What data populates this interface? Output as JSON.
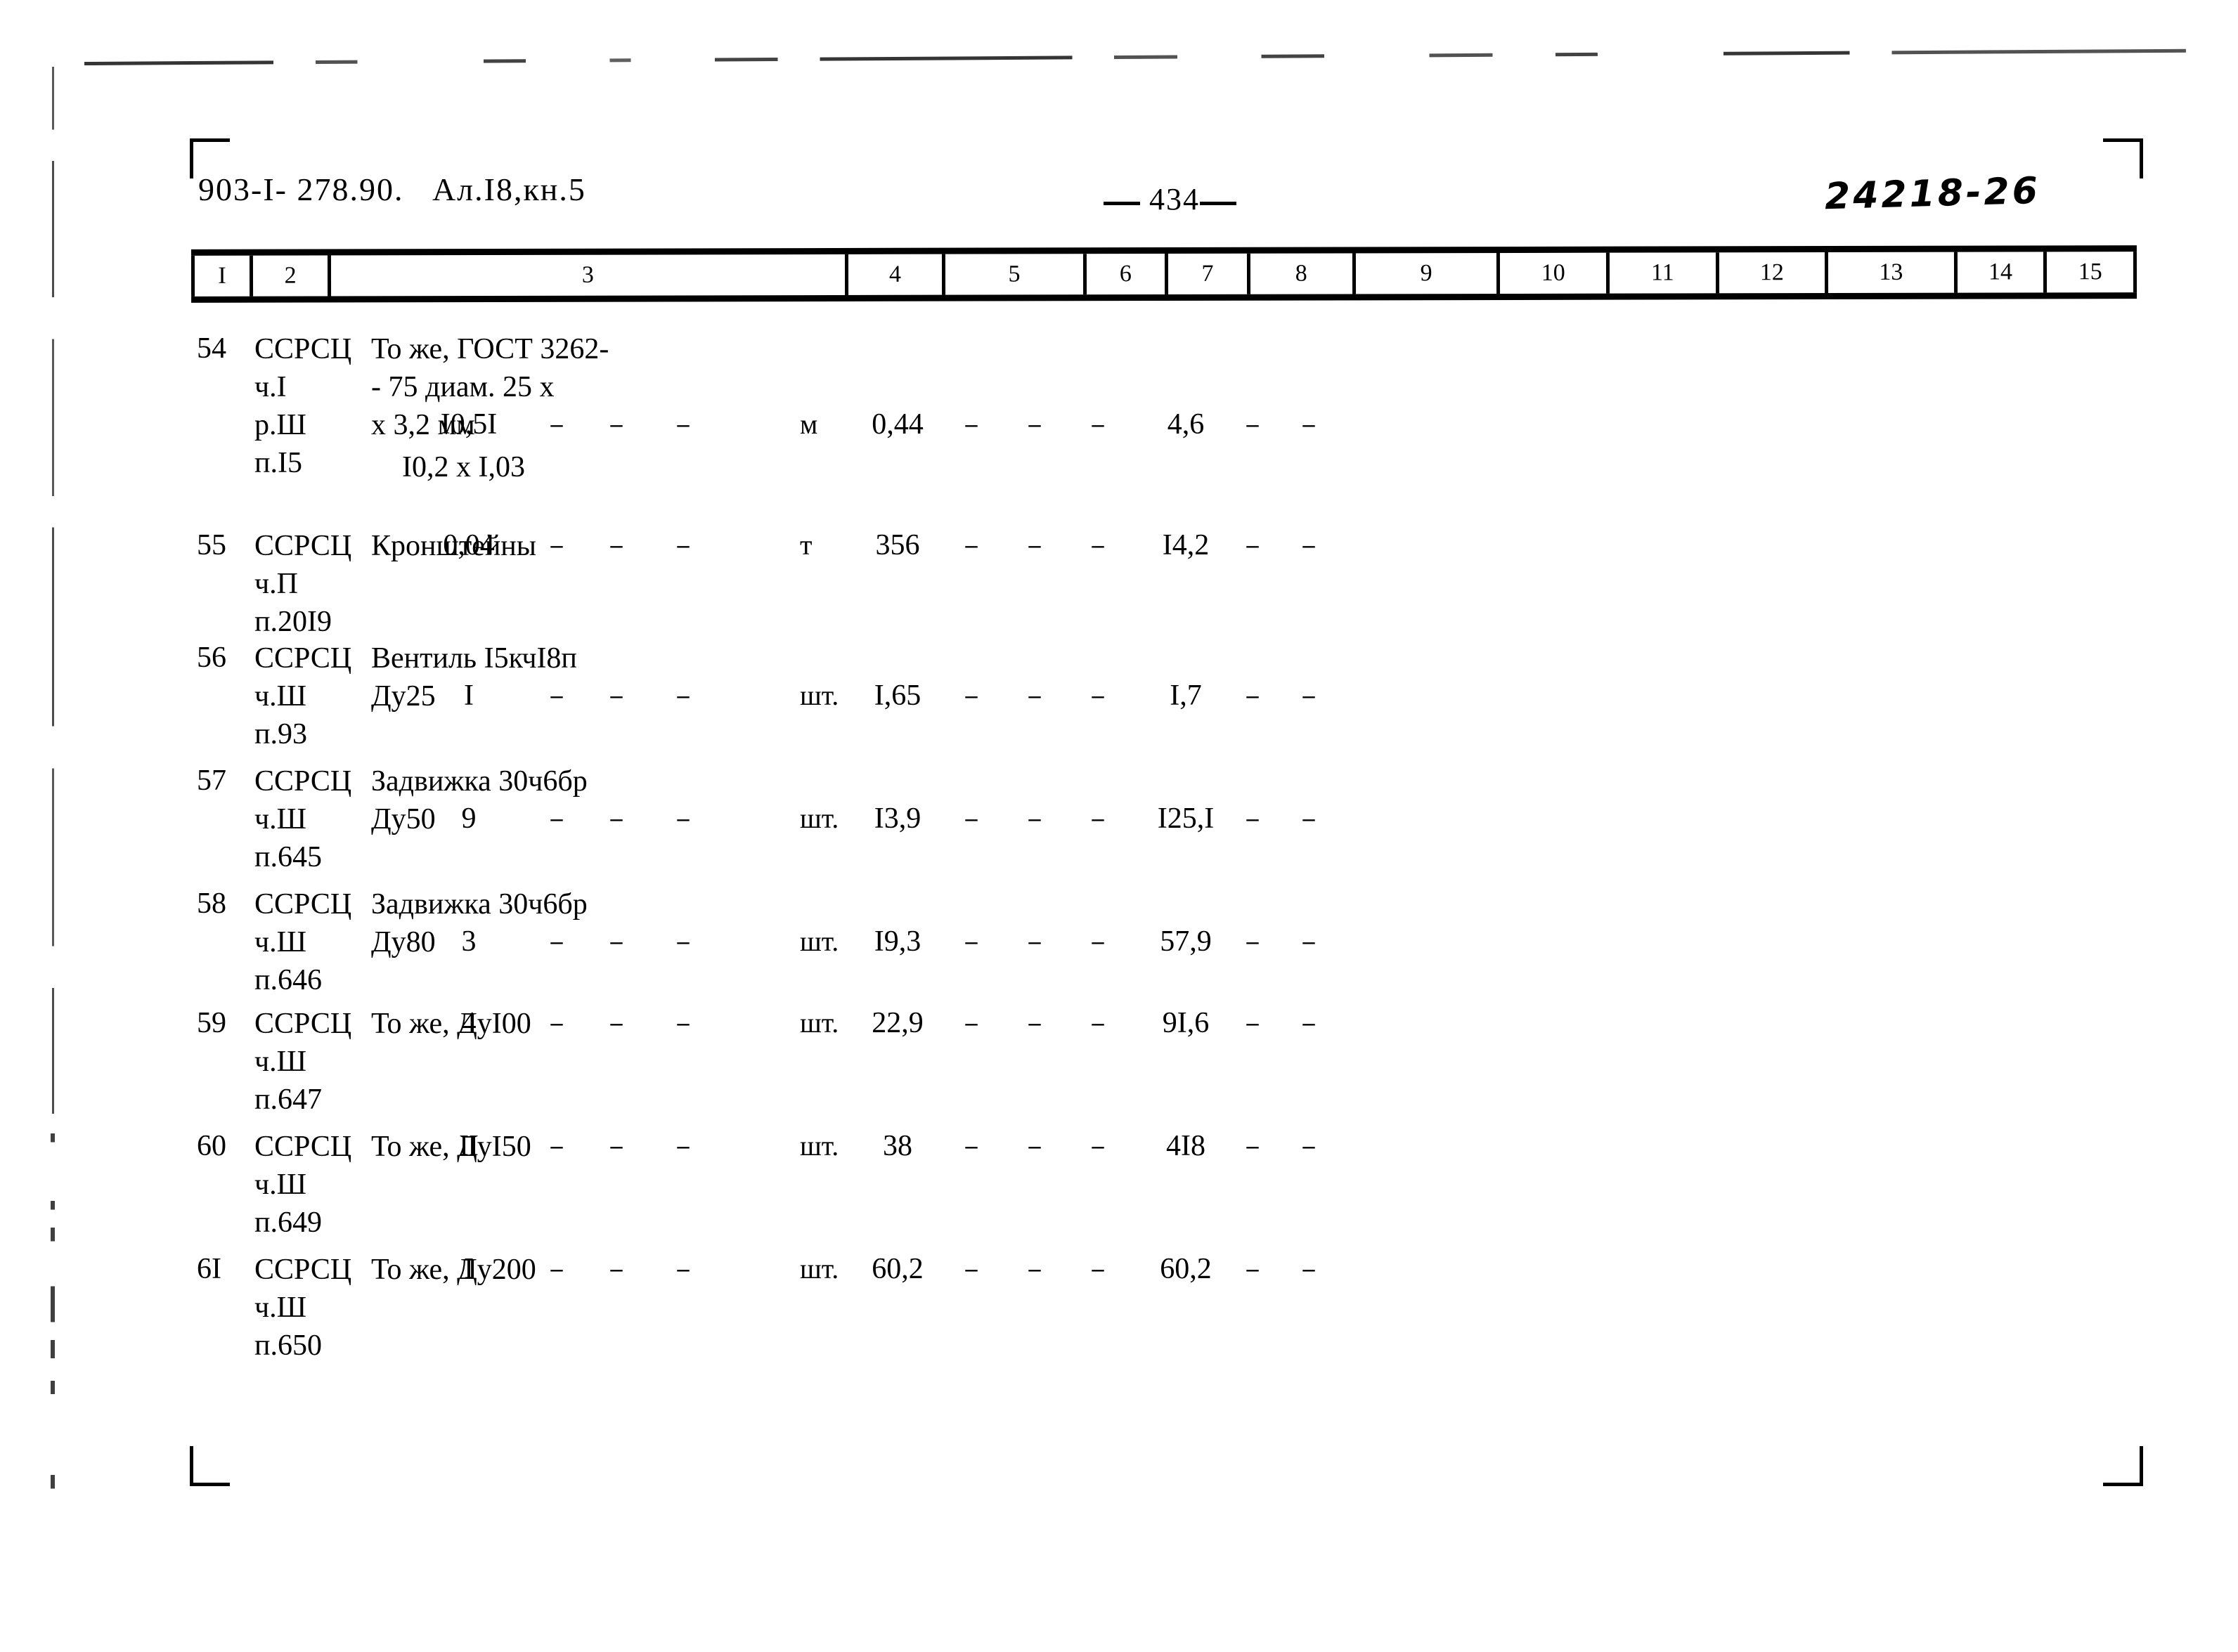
{
  "header": {
    "left_code": "903-I- 278.90.   Ал.I8,кн.5",
    "page_number": "434",
    "right_code": "24218-26"
  },
  "table": {
    "column_headers": [
      "I",
      "2",
      "3",
      "4",
      "5",
      "6",
      "7",
      "8",
      "9",
      "10",
      "11",
      "12",
      "13",
      "14",
      "15"
    ],
    "rows": [
      {
        "num": "54",
        "code": "ССРСЦ\nч.I\nр.Ш\nп.I5",
        "name": "То же, ГОСТ 3262-\n- 75 диам. 25 х\nх 3,2 мм",
        "name_extra": "I0,2 х I,03",
        "unit": "м",
        "c5": "I0,5I",
        "c6": "–",
        "c7": "–",
        "c8": "–",
        "c9": "0,44",
        "c10": "–",
        "c11": "–",
        "c12": "–",
        "c13": "4,6",
        "c14": "–",
        "c15": "–"
      },
      {
        "num": "55",
        "code": "ССРСЦ\nч.П\nп.20I9",
        "name": "Кронштейны",
        "name_extra": "",
        "unit": "т",
        "c5": "0,04",
        "c6": "–",
        "c7": "–",
        "c8": "–",
        "c9": "356",
        "c10": "–",
        "c11": "–",
        "c12": "–",
        "c13": "I4,2",
        "c14": "–",
        "c15": "–"
      },
      {
        "num": "56",
        "code": "ССРСЦ\nч.Ш\nп.93",
        "name": "Вентиль I5кчI8п\nДу25",
        "name_extra": "",
        "unit": "шт.",
        "c5": "I",
        "c6": "–",
        "c7": "–",
        "c8": "–",
        "c9": "I,65",
        "c10": "–",
        "c11": "–",
        "c12": "–",
        "c13": "I,7",
        "c14": "–",
        "c15": "–"
      },
      {
        "num": "57",
        "code": "ССРСЦ\nч.Ш\nп.645",
        "name": "Задвижка 30ч6бр\nДу50",
        "name_extra": "",
        "unit": "шт.",
        "c5": "9",
        "c6": "–",
        "c7": "–",
        "c8": "–",
        "c9": "I3,9",
        "c10": "–",
        "c11": "–",
        "c12": "–",
        "c13": "I25,I",
        "c14": "–",
        "c15": "–"
      },
      {
        "num": "58",
        "code": "ССРСЦ\nч.Ш\nп.646",
        "name": "Задвижка 30ч6бр\nДу80",
        "name_extra": "",
        "unit": "шт.",
        "c5": "3",
        "c6": "–",
        "c7": "–",
        "c8": "–",
        "c9": "I9,3",
        "c10": "–",
        "c11": "–",
        "c12": "–",
        "c13": "57,9",
        "c14": "–",
        "c15": "–"
      },
      {
        "num": "59",
        "code": "ССРСЦ\nч.Ш\nп.647",
        "name": "То же, ДуI00",
        "name_extra": "",
        "unit": "шт.",
        "c5": "4",
        "c6": "–",
        "c7": "–",
        "c8": "–",
        "c9": "22,9",
        "c10": "–",
        "c11": "–",
        "c12": "–",
        "c13": "9I,6",
        "c14": "–",
        "c15": "–"
      },
      {
        "num": "60",
        "code": "ССРСЦ\nч.Ш\nп.649",
        "name": "То же, ДуI50",
        "name_extra": "",
        "unit": "шт.",
        "c5": "II",
        "c6": "–",
        "c7": "–",
        "c8": "–",
        "c9": "38",
        "c10": "–",
        "c11": "–",
        "c12": "–",
        "c13": "4I8",
        "c14": "–",
        "c15": "–"
      },
      {
        "num": "6I",
        "code": "ССРСЦ\nч.Ш\nп.650",
        "name": "То же, Ду200",
        "name_extra": "",
        "unit": "шт.",
        "c5": "I",
        "c6": "–",
        "c7": "–",
        "c8": "–",
        "c9": "60,2",
        "c10": "–",
        "c11": "–",
        "c12": "–",
        "c13": "60,2",
        "c14": "–",
        "c15": "–"
      }
    ]
  }
}
